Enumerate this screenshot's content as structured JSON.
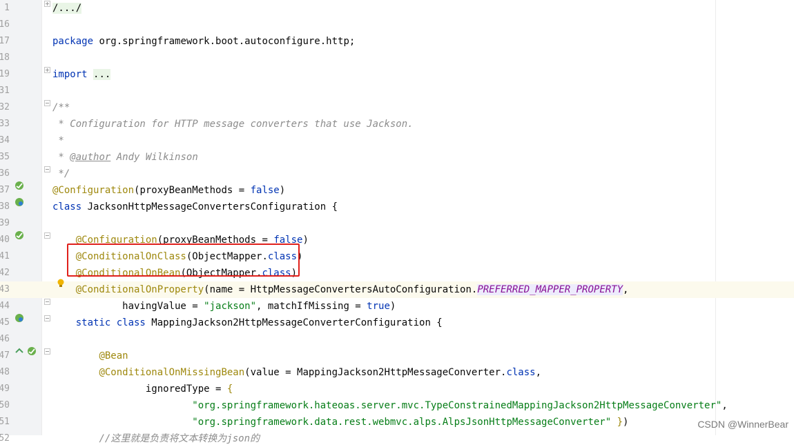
{
  "editor": {
    "lines": [
      {
        "number": "1",
        "html": "<span class=\"fold-bg\">/.../</span>"
      },
      {
        "number": "16",
        "html": ""
      },
      {
        "number": "17",
        "html": "<span class=\"t-key\">package</span> org.springframework.boot.autoconfigure.http;"
      },
      {
        "number": "18",
        "html": ""
      },
      {
        "number": "19",
        "html": "<span class=\"t-key\">import</span> <span class=\"fold-bg\">...</span>"
      },
      {
        "number": "31",
        "html": ""
      },
      {
        "number": "32",
        "html": "<span class=\"t-com\">/**</span>"
      },
      {
        "number": "33",
        "html": "<span class=\"t-com\"> * Configuration for HTTP message converters that use Jackson.</span>"
      },
      {
        "number": "34",
        "html": "<span class=\"t-com\"> *</span>"
      },
      {
        "number": "35",
        "html": "<span class=\"t-com\"> * </span><span class=\"t-tag\">@author</span><span class=\"t-com\"> Andy Wilkinson</span>"
      },
      {
        "number": "36",
        "html": "<span class=\"t-com\"> */</span>"
      },
      {
        "number": "37",
        "html": "<span class=\"t-ann\">@Configuration</span>(proxyBeanMethods = <span class=\"t-key\">false</span>)"
      },
      {
        "number": "38",
        "html": "<span class=\"t-key\">class</span> JacksonHttpMessageConvertersConfiguration {"
      },
      {
        "number": "39",
        "html": ""
      },
      {
        "number": "40",
        "html": "    <span class=\"t-ann\">@Configuration</span>(proxyBeanMethods = <span class=\"t-key\">false</span>)"
      },
      {
        "number": "41",
        "html": "    <span class=\"t-ann\">@ConditionalOnClass</span>(ObjectMapper.<span class=\"t-key\">class</span>)"
      },
      {
        "number": "42",
        "html": "    <span class=\"t-ann\">@ConditionalOnBean</span>(ObjectMapper.<span class=\"t-key\">class</span>)"
      },
      {
        "number": "43",
        "html": "    <span class=\"t-ann\">@ConditionalOnProperty</span>(name = HttpMessageConvertersAutoConfiguration.<span class=\"t-const\">PREFERRED_MAPPER_PROPERTY</span>,"
      },
      {
        "number": "44",
        "html": "            havingValue = <span class=\"t-str\">\"jackson\"</span>, matchIfMissing = <span class=\"t-key\">true</span>)"
      },
      {
        "number": "45",
        "html": "    <span class=\"t-key\">static class</span> MappingJackson2HttpMessageConverterConfiguration {"
      },
      {
        "number": "46",
        "html": ""
      },
      {
        "number": "47",
        "html": "        <span class=\"t-ann\">@Bean</span>"
      },
      {
        "number": "48",
        "html": "        <span class=\"t-ann\">@ConditionalOnMissingBean</span>(value = MappingJackson2HttpMessageConverter.<span class=\"t-key\">class</span>,"
      },
      {
        "number": "49",
        "html": "                ignoredType = <span class=\"t-ann\">{</span>"
      },
      {
        "number": "50",
        "html": "                        <span class=\"t-str\">\"org.springframework.hateoas.server.mvc.TypeConstrainedMappingJackson2HttpMessageConverter\"</span>,"
      },
      {
        "number": "51",
        "html": "                        <span class=\"t-str\">\"org.springframework.data.rest.webmvc.alps.AlpsJsonHttpMessageConverter\"</span> <span class=\"t-ann\">}</span>)"
      },
      {
        "number": "52",
        "html": "        <span class=\"t-com\">//这里就是负责将文本转换为json的</span>"
      }
    ],
    "current_line_index": 17,
    "accent_colors": {
      "keyword": "#0033b3",
      "annotation": "#9e880d",
      "string": "#067d17",
      "highlight_box": "#e0201b"
    }
  },
  "watermark": "CSDN @WinnerBear"
}
